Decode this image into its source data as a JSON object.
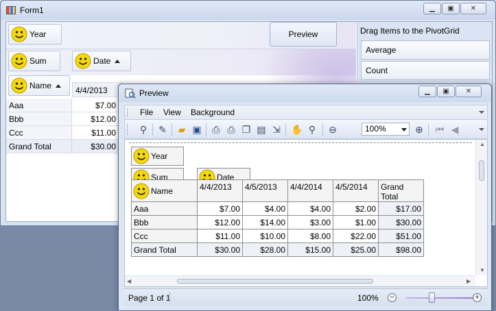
{
  "form1": {
    "title": "Form1",
    "filter_fields": [
      {
        "label": "Year"
      }
    ],
    "data_fields": [
      {
        "label": "Sum"
      }
    ],
    "column_fields": [
      {
        "label": "Date"
      }
    ],
    "row_fields": [
      {
        "label": "Name"
      }
    ],
    "preview_button": "Preview",
    "field_list": {
      "header": "Drag Items to the PivotGrid",
      "items": [
        "Average",
        "Count"
      ]
    },
    "grid": {
      "column_header": "4/4/2013",
      "rows": [
        {
          "name": "Aaa",
          "value": "$7.00"
        },
        {
          "name": "Bbb",
          "value": "$12.00"
        },
        {
          "name": "Ccc",
          "value": "$11.00"
        },
        {
          "name": "Grand Total",
          "value": "$30.00"
        }
      ]
    }
  },
  "preview": {
    "title": "Preview",
    "menu": [
      "File",
      "View",
      "Background"
    ],
    "zoom_value": "100%",
    "report": {
      "filter_label": "Year",
      "data_label": "Sum",
      "column_label": "Date",
      "row_label": "Name",
      "columns": [
        "4/4/2013",
        "4/5/2013",
        "4/4/2014",
        "4/5/2014",
        "Grand Total"
      ],
      "rows": [
        {
          "name": "Aaa",
          "values": [
            "$7.00",
            "$4.00",
            "$4.00",
            "$2.00",
            "$17.00"
          ]
        },
        {
          "name": "Bbb",
          "values": [
            "$12.00",
            "$14.00",
            "$3.00",
            "$1.00",
            "$30.00"
          ]
        },
        {
          "name": "Ccc",
          "values": [
            "$11.00",
            "$10.00",
            "$8.00",
            "$22.00",
            "$51.00"
          ]
        },
        {
          "name": "Grand Total",
          "values": [
            "$30.00",
            "$28.00",
            "$15.00",
            "$25.00",
            "$98.00"
          ]
        }
      ]
    },
    "status": {
      "page": "Page 1 of 1",
      "zoom": "100%"
    }
  }
}
